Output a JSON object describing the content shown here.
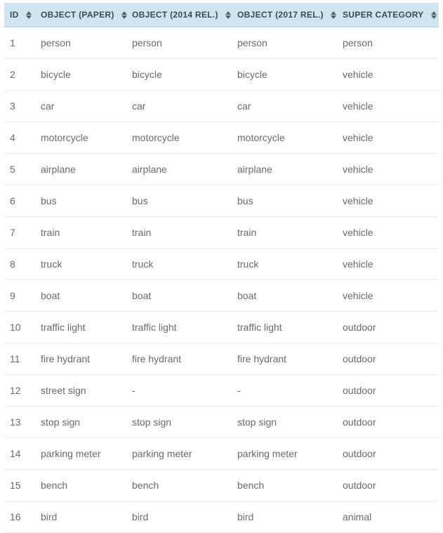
{
  "columns": [
    {
      "key": "id",
      "label": "ID",
      "sortable": true
    },
    {
      "key": "object_paper",
      "label": "OBJECT (PAPER)",
      "sortable": true
    },
    {
      "key": "object_2014",
      "label": "OBJECT (2014 REL.)",
      "sortable": true
    },
    {
      "key": "object_2017",
      "label": "OBJECT (2017 REL.)",
      "sortable": true
    },
    {
      "key": "super_category",
      "label": "SUPER CATEGORY",
      "sortable": true
    }
  ],
  "rows": [
    {
      "id": "1",
      "object_paper": "person",
      "object_2014": "person",
      "object_2017": "person",
      "super_category": "person"
    },
    {
      "id": "2",
      "object_paper": "bicycle",
      "object_2014": "bicycle",
      "object_2017": "bicycle",
      "super_category": "vehicle"
    },
    {
      "id": "3",
      "object_paper": "car",
      "object_2014": "car",
      "object_2017": "car",
      "super_category": "vehicle"
    },
    {
      "id": "4",
      "object_paper": "motorcycle",
      "object_2014": "motorcycle",
      "object_2017": "motorcycle",
      "super_category": "vehicle"
    },
    {
      "id": "5",
      "object_paper": "airplane",
      "object_2014": "airplane",
      "object_2017": "airplane",
      "super_category": "vehicle"
    },
    {
      "id": "6",
      "object_paper": "bus",
      "object_2014": "bus",
      "object_2017": "bus",
      "super_category": "vehicle"
    },
    {
      "id": "7",
      "object_paper": "train",
      "object_2014": "train",
      "object_2017": "train",
      "super_category": "vehicle"
    },
    {
      "id": "8",
      "object_paper": "truck",
      "object_2014": "truck",
      "object_2017": "truck",
      "super_category": "vehicle"
    },
    {
      "id": "9",
      "object_paper": "boat",
      "object_2014": "boat",
      "object_2017": "boat",
      "super_category": "vehicle"
    },
    {
      "id": "10",
      "object_paper": "traffic light",
      "object_2014": "traffic light",
      "object_2017": "traffic light",
      "super_category": "outdoor"
    },
    {
      "id": "11",
      "object_paper": "fire hydrant",
      "object_2014": "fire hydrant",
      "object_2017": "fire hydrant",
      "super_category": "outdoor"
    },
    {
      "id": "12",
      "object_paper": "street sign",
      "object_2014": "-",
      "object_2017": "-",
      "super_category": "outdoor"
    },
    {
      "id": "13",
      "object_paper": "stop sign",
      "object_2014": "stop sign",
      "object_2017": "stop sign",
      "super_category": "outdoor"
    },
    {
      "id": "14",
      "object_paper": "parking meter",
      "object_2014": "parking meter",
      "object_2017": "parking meter",
      "super_category": "outdoor"
    },
    {
      "id": "15",
      "object_paper": "bench",
      "object_2014": "bench",
      "object_2017": "bench",
      "super_category": "outdoor"
    },
    {
      "id": "16",
      "object_paper": "bird",
      "object_2014": "bird",
      "object_2017": "bird",
      "super_category": "animal"
    }
  ],
  "colors": {
    "header_bg": "#cfe5ef",
    "border": "#e9eceb",
    "text": "#6b6b6b",
    "sort_arrow": "#3a4a52"
  }
}
